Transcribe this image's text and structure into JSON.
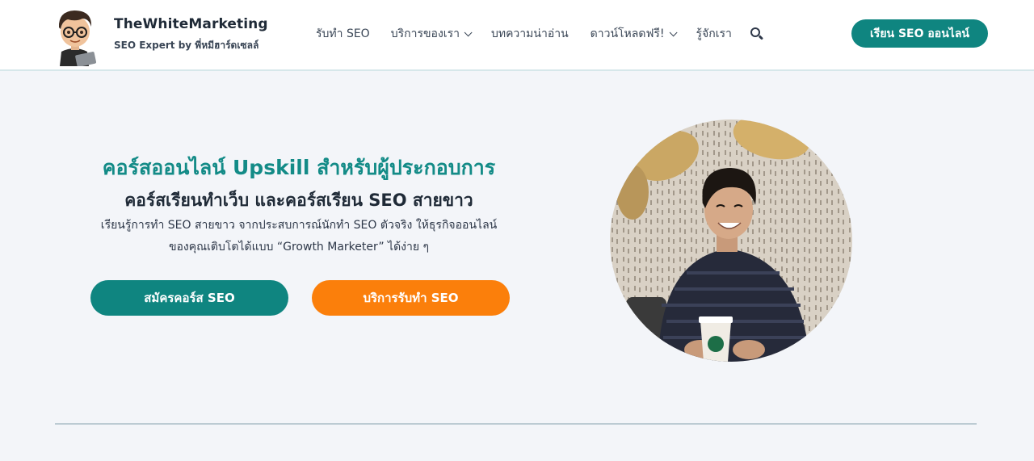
{
  "header": {
    "brand_title": "TheWhiteMarketing",
    "brand_subtitle": "SEO Expert by พี่หมีฮาร์ดเซลล์",
    "nav": [
      {
        "label": "รับทำ SEO",
        "has_dropdown": false
      },
      {
        "label": "บริการของเรา",
        "has_dropdown": true
      },
      {
        "label": "บทความน่าอ่าน",
        "has_dropdown": false
      },
      {
        "label": "ดาวน์โหลดฟรี!",
        "has_dropdown": true
      },
      {
        "label": "รู้จักเรา",
        "has_dropdown": false
      }
    ],
    "search_icon": "search-icon",
    "cta_label": "เรียน SEO ออนไลน์"
  },
  "hero": {
    "title": "คอร์สออนไลน์ Upskill สำหรับผู้ประกอบการ",
    "subtitle": "คอร์สเรียนทำเว็บ และคอร์สเรียน SEO สายขาว",
    "description_line1": "เรียนรู้การทำ SEO สายขาว จากประสบการณ์นักทำ SEO ตัวจริง ให้ธุรกิจออนไลน์",
    "description_line2": "ของคุณเติบโตได้แบบ “Growth Marketer” ได้ง่าย ๆ",
    "button_course": "สมัครคอร์ส SEO",
    "button_service": "บริการรับทำ SEO"
  },
  "colors": {
    "accent_teal": "#0f8580",
    "accent_orange": "#fb7f0b",
    "background": "#f3f5f9"
  }
}
